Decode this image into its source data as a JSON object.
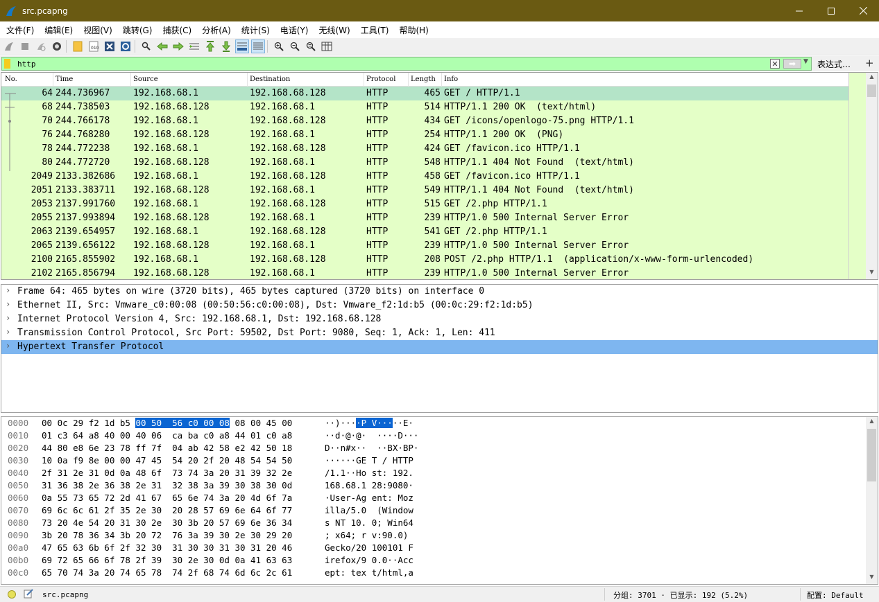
{
  "window": {
    "title": "src.pcapng"
  },
  "menu": [
    "文件(F)",
    "编辑(E)",
    "视图(V)",
    "跳转(G)",
    "捕获(C)",
    "分析(A)",
    "统计(S)",
    "电话(Y)",
    "无线(W)",
    "工具(T)",
    "帮助(H)"
  ],
  "toolbar_icons": [
    "start-capture-icon",
    "stop-capture-icon",
    "restart-capture-icon",
    "capture-options-icon",
    "open-file-icon",
    "save-file-icon",
    "close-file-icon",
    "reload-icon",
    "find-packet-icon",
    "go-back-icon",
    "go-forward-icon",
    "go-to-packet-icon",
    "first-packet-icon",
    "last-packet-icon",
    "autoscroll-icon",
    "colorize-icon",
    "zoom-in-icon",
    "zoom-out-icon",
    "normal-size-icon",
    "resize-columns-icon"
  ],
  "filter": {
    "value": "http",
    "expression_label": "表达式…",
    "add_label": "+"
  },
  "packet_list": {
    "columns": [
      "No.",
      "Time",
      "Source",
      "Destination",
      "Protocol",
      "Length",
      "Info"
    ],
    "rows": [
      {
        "no": "64",
        "time": "244.736967",
        "src": "192.168.68.1",
        "dst": "192.168.68.128",
        "proto": "HTTP",
        "len": "465",
        "info": "GET / HTTP/1.1"
      },
      {
        "no": "68",
        "time": "244.738503",
        "src": "192.168.68.128",
        "dst": "192.168.68.1",
        "proto": "HTTP",
        "len": "514",
        "info": "HTTP/1.1 200 OK  (text/html)"
      },
      {
        "no": "70",
        "time": "244.766178",
        "src": "192.168.68.1",
        "dst": "192.168.68.128",
        "proto": "HTTP",
        "len": "434",
        "info": "GET /icons/openlogo-75.png HTTP/1.1"
      },
      {
        "no": "76",
        "time": "244.768280",
        "src": "192.168.68.128",
        "dst": "192.168.68.1",
        "proto": "HTTP",
        "len": "254",
        "info": "HTTP/1.1 200 OK  (PNG)"
      },
      {
        "no": "78",
        "time": "244.772238",
        "src": "192.168.68.1",
        "dst": "192.168.68.128",
        "proto": "HTTP",
        "len": "424",
        "info": "GET /favicon.ico HTTP/1.1"
      },
      {
        "no": "80",
        "time": "244.772720",
        "src": "192.168.68.128",
        "dst": "192.168.68.1",
        "proto": "HTTP",
        "len": "548",
        "info": "HTTP/1.1 404 Not Found  (text/html)"
      },
      {
        "no": "2049",
        "time": "2133.382686",
        "src": "192.168.68.1",
        "dst": "192.168.68.128",
        "proto": "HTTP",
        "len": "458",
        "info": "GET /favicon.ico HTTP/1.1"
      },
      {
        "no": "2051",
        "time": "2133.383711",
        "src": "192.168.68.128",
        "dst": "192.168.68.1",
        "proto": "HTTP",
        "len": "549",
        "info": "HTTP/1.1 404 Not Found  (text/html)"
      },
      {
        "no": "2053",
        "time": "2137.991760",
        "src": "192.168.68.1",
        "dst": "192.168.68.128",
        "proto": "HTTP",
        "len": "515",
        "info": "GET /2.php HTTP/1.1"
      },
      {
        "no": "2055",
        "time": "2137.993894",
        "src": "192.168.68.128",
        "dst": "192.168.68.1",
        "proto": "HTTP",
        "len": "239",
        "info": "HTTP/1.0 500 Internal Server Error"
      },
      {
        "no": "2063",
        "time": "2139.654957",
        "src": "192.168.68.1",
        "dst": "192.168.68.128",
        "proto": "HTTP",
        "len": "541",
        "info": "GET /2.php HTTP/1.1"
      },
      {
        "no": "2065",
        "time": "2139.656122",
        "src": "192.168.68.128",
        "dst": "192.168.68.1",
        "proto": "HTTP",
        "len": "239",
        "info": "HTTP/1.0 500 Internal Server Error"
      },
      {
        "no": "2100",
        "time": "2165.855902",
        "src": "192.168.68.1",
        "dst": "192.168.68.128",
        "proto": "HTTP",
        "len": "208",
        "info": "POST /2.php HTTP/1.1  (application/x-www-form-urlencoded)"
      },
      {
        "no": "2102",
        "time": "2165.856794",
        "src": "192.168.68.128",
        "dst": "192.168.68.1",
        "proto": "HTTP",
        "len": "239",
        "info": "HTTP/1.0 500 Internal Server Error"
      }
    ]
  },
  "packet_details": [
    "Frame 64: 465 bytes on wire (3720 bits), 465 bytes captured (3720 bits) on interface 0",
    "Ethernet II, Src: Vmware_c0:00:08 (00:50:56:c0:00:08), Dst: Vmware_f2:1d:b5 (00:0c:29:f2:1d:b5)",
    "Internet Protocol Version 4, Src: 192.168.68.1, Dst: 192.168.68.128",
    "Transmission Control Protocol, Src Port: 59502, Dst Port: 9080, Seq: 1, Ack: 1, Len: 411",
    "Hypertext Transfer Protocol"
  ],
  "packet_bytes": [
    {
      "offset": "0000",
      "hex": [
        "00 0c 29 f2 1d b5 ",
        "00 50  56 c0 00 08",
        " 08 00 45 00"
      ],
      "ascii": [
        "··)···",
        "·P V···",
        "··E·"
      ]
    },
    {
      "offset": "0010",
      "hex": [
        "01 c3 64 a8 40 00 40 06  ca ba c0 a8 44 01 c0 a8"
      ],
      "ascii": [
        "··d·@·@·  ····D···"
      ]
    },
    {
      "offset": "0020",
      "hex": [
        "44 80 e8 6e 23 78 ff 7f  04 ab 42 58 e2 42 50 18"
      ],
      "ascii": [
        "D··n#x··  ··BX·BP·"
      ]
    },
    {
      "offset": "0030",
      "hex": [
        "10 0a f9 8e 00 00 47 45  54 20 2f 20 48 54 54 50"
      ],
      "ascii": [
        "······GE T / HTTP"
      ]
    },
    {
      "offset": "0040",
      "hex": [
        "2f 31 2e 31 0d 0a 48 6f  73 74 3a 20 31 39 32 2e"
      ],
      "ascii": [
        "/1.1··Ho st: 192."
      ]
    },
    {
      "offset": "0050",
      "hex": [
        "31 36 38 2e 36 38 2e 31  32 38 3a 39 30 38 30 0d"
      ],
      "ascii": [
        "168.68.1 28:9080·"
      ]
    },
    {
      "offset": "0060",
      "hex": [
        "0a 55 73 65 72 2d 41 67  65 6e 74 3a 20 4d 6f 7a"
      ],
      "ascii": [
        "·User-Ag ent: Moz"
      ]
    },
    {
      "offset": "0070",
      "hex": [
        "69 6c 6c 61 2f 35 2e 30  20 28 57 69 6e 64 6f 77"
      ],
      "ascii": [
        "illa/5.0  (Window"
      ]
    },
    {
      "offset": "0080",
      "hex": [
        "73 20 4e 54 20 31 30 2e  30 3b 20 57 69 6e 36 34"
      ],
      "ascii": [
        "s NT 10. 0; Win64"
      ]
    },
    {
      "offset": "0090",
      "hex": [
        "3b 20 78 36 34 3b 20 72  76 3a 39 30 2e 30 29 20"
      ],
      "ascii": [
        "; x64; r v:90.0)"
      ]
    },
    {
      "offset": "00a0",
      "hex": [
        "47 65 63 6b 6f 2f 32 30  31 30 30 31 30 31 20 46"
      ],
      "ascii": [
        "Gecko/20 100101 F"
      ]
    },
    {
      "offset": "00b0",
      "hex": [
        "69 72 65 66 6f 78 2f 39  30 2e 30 0d 0a 41 63 63"
      ],
      "ascii": [
        "irefox/9 0.0··Acc"
      ]
    },
    {
      "offset": "00c0",
      "hex": [
        "65 70 74 3a 20 74 65 78  74 2f 68 74 6d 6c 2c 61"
      ],
      "ascii": [
        "ept: tex t/html,a"
      ]
    }
  ],
  "statusbar": {
    "file": "src.pcapng",
    "packets": "分组: 3701 · 已显示: 192 (5.2%)",
    "profile": "配置: Default"
  },
  "colors": {
    "titlebar": "#6a5a12",
    "filter_valid": "#afffaf",
    "http_row": "#e4ffc7",
    "selected_row": "#b4e4c8",
    "selected_detail": "#7eb6f0",
    "byte_highlight": "#0a64d2"
  }
}
